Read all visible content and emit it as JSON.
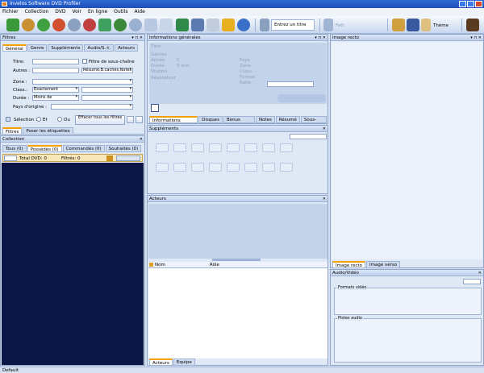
{
  "window": {
    "title": "Invelos Software DVD Profiler"
  },
  "menu": [
    "Fichier",
    "Collection",
    "DVD",
    "Voir",
    "En ligne",
    "Outils",
    "Aide"
  ],
  "toolbar": {
    "title_button": "Entrez un titre",
    "filter_button": "Fett",
    "theme_button": "Thème"
  },
  "filters": {
    "panel_title": "Filtres",
    "tabs": [
      "Général",
      "Genre",
      "Suppléments",
      "Audio/S.-t.",
      "Acteurs"
    ],
    "title_label": "Titre:",
    "title_value": "",
    "subchain_label": "Filtre de sous-chaîne",
    "others_label": "Autres :",
    "others_value": "",
    "others_select": "Résumé,B.cachés,Notes",
    "zone_label": "Zone :",
    "class_label": "Class.:",
    "class_value": "Exactement",
    "duration_label": "Durée :",
    "duration_value": "Moins de",
    "country_label": "Pays d'origine :",
    "selection_label": "Sélection :",
    "and_label": "Et",
    "or_label": "Ou",
    "clear_button": "Effacer tous les filtres",
    "bottom_tabs": [
      "Filtres",
      "Poser les étiquettes"
    ]
  },
  "collection": {
    "panel_title": "Collection",
    "tabs": [
      "Tous (0)",
      "Possédés (0)",
      "Commandés (0)",
      "Souhaités (0)"
    ],
    "total_label": "Total DVD: 0",
    "filtered_label": "Filtrés: 0"
  },
  "info": {
    "panel_title": "Informations générales",
    "fields_left": [
      "Titre",
      "Genres",
      "Année",
      "Durée",
      "Studios",
      "Réalisateur"
    ],
    "values_left": [
      "",
      "",
      "0",
      "0 min",
      "",
      ""
    ],
    "fields_right": [
      "Pays",
      "Zone",
      "Class.",
      "Format",
      "Ratio"
    ],
    "tabs": [
      "Informations générales",
      "Disques",
      "Bonus cachés",
      "Notes",
      "Résumé",
      "Sous-titres"
    ]
  },
  "supplements": {
    "panel_title": "Suppléments"
  },
  "actors": {
    "panel_title": "Acteurs",
    "col_name": "Nom",
    "col_role": "Rôle",
    "tabs": [
      "Acteurs",
      "Equipe"
    ]
  },
  "image": {
    "panel_title": "Image recto",
    "tabs": [
      "Image recto",
      "Image verso"
    ]
  },
  "audiovideo": {
    "panel_title": "Audio/Vidéo",
    "video_formats": "Formats vidéo",
    "audio_tracks": "Pistes audio"
  },
  "status": {
    "text": "Default"
  },
  "colors": {
    "accent": "#f4a000",
    "title_bar": "#1e4fb7",
    "list_background": "#0a1646"
  }
}
